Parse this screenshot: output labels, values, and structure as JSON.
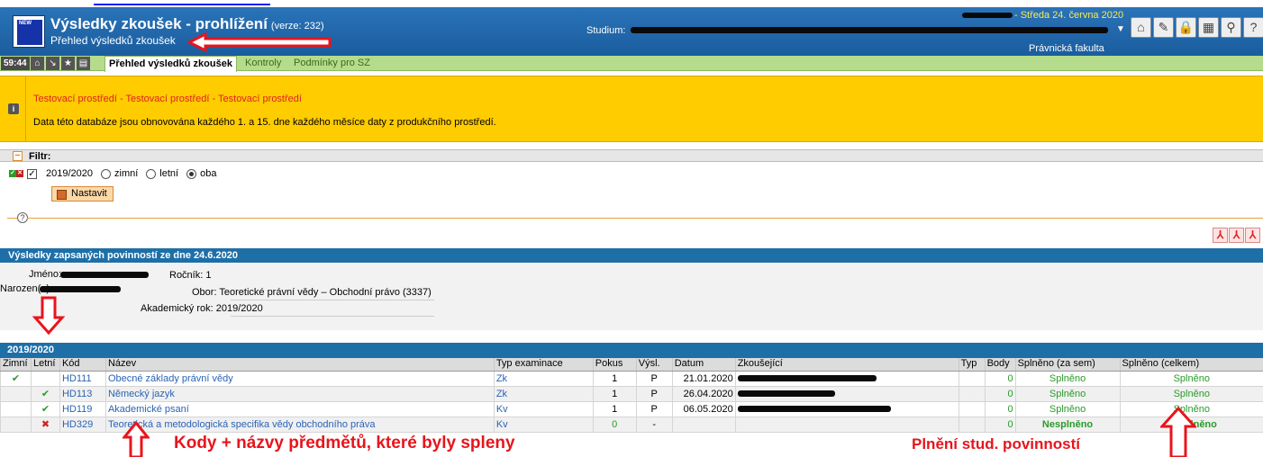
{
  "header": {
    "title": "Výsledky zkoušek - prohlížení",
    "version": "(verze: 232)",
    "subtitle": "Přehled výsledků zkoušek",
    "studium_label": "Studium:",
    "date": "- Středa 24. června 2020",
    "faculty": "Právnická fakulta",
    "logo_text": "NEW"
  },
  "navbar": {
    "time": "59:44",
    "tabs": [
      "Přehled výsledků zkoušek",
      "Kontroly",
      "Podmínky pro SZ"
    ]
  },
  "warning": {
    "title": "Testovací prostředí - Testovací prostředí - Testovací prostředí",
    "text": "Data této databáze jsou obnovována každého 1. a 15. dne každého měsíce daty z produkčního prostředí."
  },
  "filter": {
    "label": "Filtr:",
    "year": "2019/2020",
    "semesters": [
      "zimní",
      "letní",
      "oba"
    ],
    "selected": "oba",
    "button": "Nastavit"
  },
  "results": {
    "heading": "Výsledky zapsaných povinností ze dne 24.6.2020",
    "name_label": "Jméno:",
    "birth_label": "Narozen(a):",
    "rocnik_label": "Ročník:",
    "rocnik": "1",
    "obor_label": "Obor:",
    "obor": "Teoretické právní vědy – Obchodní právo (3337)",
    "akad_label": "Akademický rok:",
    "akad": "2019/2020"
  },
  "table": {
    "year_heading": "2019/2020",
    "columns": [
      "Zimní",
      "Letní",
      "Kód",
      "Název",
      "Typ examinace",
      "Pokus",
      "Výsl.",
      "Datum",
      "Zkoušející",
      "Typ",
      "Body",
      "Splněno (za sem)",
      "Splněno (celkem)"
    ],
    "rows": [
      {
        "zimni": "✔",
        "letni": "",
        "kod": "HD111",
        "nazev": "Obecné základy právní vědy",
        "typ": "Zk",
        "pokus": "1",
        "vysl": "P",
        "datum": "21.01.2020",
        "body": "0",
        "sem": "Splněno",
        "celkem": "Splněno"
      },
      {
        "zimni": "",
        "letni": "✔",
        "kod": "HD113",
        "nazev": "Německý jazyk",
        "typ": "Zk",
        "pokus": "1",
        "vysl": "P",
        "datum": "26.04.2020",
        "body": "0",
        "sem": "Splněno",
        "celkem": "Splněno"
      },
      {
        "zimni": "",
        "letni": "✔",
        "kod": "HD119",
        "nazev": "Akademické psaní",
        "typ": "Kv",
        "pokus": "1",
        "vysl": "P",
        "datum": "06.05.2020",
        "body": "0",
        "sem": "Splněno",
        "celkem": "Splněno"
      },
      {
        "zimni": "",
        "letni": "✖",
        "kod": "HD329",
        "nazev": "Teoretická a metodologická specifika vědy obchodního práva",
        "typ": "Kv",
        "pokus": "0",
        "vysl": "-",
        "datum": "",
        "body": "0",
        "sem": "Nesplněno",
        "celkem": "Nesplněno"
      }
    ]
  },
  "annotations": {
    "left": "Kody + názvy předmětů, které byly spleny",
    "right": "Plnění stud. povinností"
  },
  "colors": {
    "header_blue": "#1a5d9e",
    "section_blue": "#1e6fa8",
    "warning_yellow": "#ffcc00",
    "nav_green": "#b5dc8c",
    "annotation_red": "#e8141c"
  }
}
